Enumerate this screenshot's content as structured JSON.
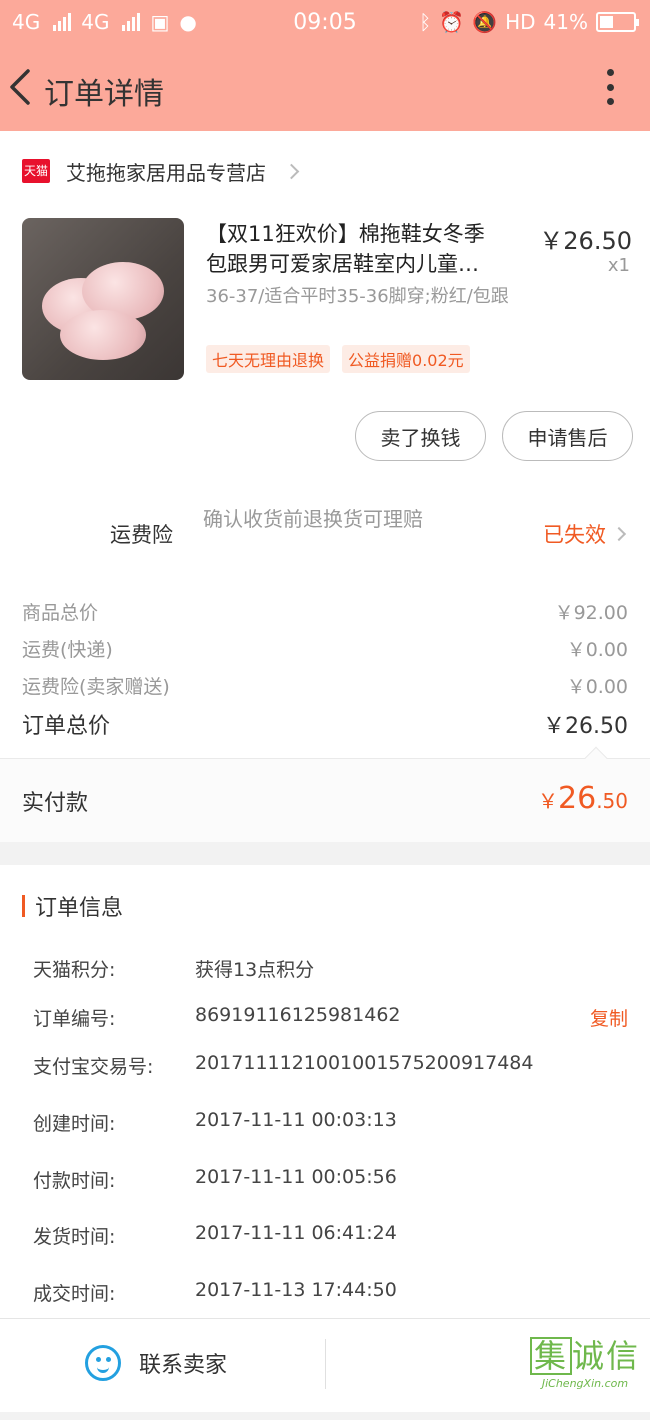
{
  "status": {
    "left": [
      "4G",
      "4G"
    ],
    "time": "09:05",
    "right_text": "HD",
    "battery": "41%",
    "battery_level": 0.41
  },
  "nav": {
    "title": "订单详情"
  },
  "store": {
    "badge": "天猫",
    "name": "艾拖拖家居用品专营店"
  },
  "product": {
    "title_line1": "【双11狂欢价】棉拖鞋女冬季",
    "title_line2": "包跟男可爱家居鞋室内儿童…",
    "price": "￥26.50",
    "qty": "x1",
    "sku": "36-37/适合平时35-36脚穿;粉红/包跟",
    "tags": [
      "七天无理由退换",
      "公益捐赠0.02元"
    ]
  },
  "actions": {
    "sell": "卖了换钱",
    "after_sale": "申请售后"
  },
  "insurance": {
    "label": "运费险",
    "desc": "确认收货前退换货可理赔",
    "status": "已失效"
  },
  "price_rows": [
    {
      "k": "商品总价",
      "v": "￥92.00"
    },
    {
      "k": "运费(快递)",
      "v": "￥0.00"
    },
    {
      "k": "运费险(卖家赠送)",
      "v": "￥0.00"
    }
  ],
  "total": {
    "k": "订单总价",
    "v": "￥26.50"
  },
  "paid": {
    "label": "实付款",
    "currency": "￥",
    "int": "26",
    "dec": ".50"
  },
  "order_info": {
    "title": "订单信息",
    "copy": "复制",
    "rows": [
      {
        "k": "天猫积分:",
        "v": "获得13点积分"
      },
      {
        "k": "订单编号:",
        "v": "86919116125981462"
      },
      {
        "k": "支付宝交易号:",
        "v": "20171111210010015752009174​84"
      },
      {
        "k": "创建时间:",
        "v": "2017-11-11 00:03:13"
      },
      {
        "k": "付款时间:",
        "v": "2017-11-11 00:05:56"
      },
      {
        "k": "发货时间:",
        "v": "2017-11-11 06:41:24"
      },
      {
        "k": "成交时间:",
        "v": "2017-11-13 17:44:50"
      }
    ]
  },
  "bottom": {
    "contact": "联系卖家"
  },
  "watermark": {
    "zh_box": "集",
    "zh_rest": "诚信",
    "en": "JiChengXin.com"
  }
}
